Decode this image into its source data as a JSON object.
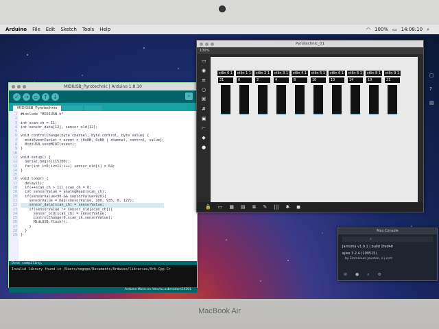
{
  "menubar": {
    "app": "Arduino",
    "items": [
      "File",
      "Edit",
      "Sketch",
      "Tools",
      "Help"
    ],
    "battery": "100%",
    "clock": "14:08:10"
  },
  "arduino": {
    "title": "MIDIUSB_Pyrotechnic | Arduino 1.8.10",
    "tabs": [
      "MIDIUSB_Pyrotechnic",
      "",
      ""
    ],
    "code_lines": [
      "#include \"MIDIUSB.h\"",
      "",
      "int scan_ch = 11;",
      "int sensor_data[12], sensor_old[12];",
      "",
      "void controlChange(byte channel, byte control, byte value) {",
      "  midiEventPacket_t event = {0x0B, 0xB0 | channel, control, value};",
      "  MidiUSB.sendMIDI(event);",
      "}",
      "",
      "void setup() {",
      "  Serial.begin(115200);",
      "  for(int i=0;i<=11;i++) sensor_old[i] = 64;",
      "}",
      "",
      "void loop() {",
      "  delay(1);",
      "  if(++scan_ch > 11) scan_ch = 0;",
      "  int sensorValue = analogRead(scan_ch);",
      "  if(sensorValue<30 && sensorValue>920){",
      "    sensorValue = map(sensorValue, 100, 935, 0, 127);",
      "    sensor_data[scan_ch] = sensorValue;",
      "    if(sensorValue != sensor_old[scan_ch]){",
      "      sensor_old[scan_ch] = sensorValue;",
      "      controlChange(0,scan_ch,sensorValue);",
      "      MidiUSB.flush();",
      "    }",
      "  }",
      "}"
    ],
    "line_numbers": [
      "1",
      "2",
      "3",
      "4",
      "5",
      "6",
      "7",
      "8",
      "9",
      "10",
      "11",
      "12",
      "13",
      "14",
      "15",
      "16",
      "17",
      "18",
      "19",
      "20",
      "21",
      "22",
      "23",
      "24",
      "25",
      "26",
      "27",
      "28",
      "29"
    ],
    "console_label": "Done compiling.",
    "console_text": "Invalid library found in /Users/negope/Documents/Arduino/libraries/Ark-Cpp-Cr",
    "status": "Arduino Micro on /dev/cu.usbmodem14301"
  },
  "pyro": {
    "title": "Pyrotechnic_01",
    "zoom": "100%",
    "faders": [
      {
        "label": "ctlin 0 1",
        "value": "21",
        "level": 0.05
      },
      {
        "label": "ctlin 1 1",
        "value": "0",
        "level": 0.03
      },
      {
        "label": "ctlin 2 1",
        "value": "2",
        "level": 0.03
      },
      {
        "label": "ctlin 3 1",
        "value": "4",
        "level": 0.03
      },
      {
        "label": "ctlin 4 1",
        "value": "8",
        "level": 0.04
      },
      {
        "label": "ctlin 5 1",
        "value": "10",
        "level": 0.04
      },
      {
        "label": "ctlin 6 1",
        "value": "10",
        "level": 0.04
      },
      {
        "label": "ctlin 6 1",
        "value": "14",
        "level": 0.05
      },
      {
        "label": "ctlin 8 1",
        "value": "19",
        "level": 0.05
      },
      {
        "label": "ctlin 9 1",
        "value": "21",
        "level": 0.05
      }
    ]
  },
  "about": {
    "title": "Max Console",
    "line1": "Jamoma v1.0.1 | build 1fed48",
    "line2": "ejies 3.2.4 (100515)",
    "line3": "by Emmanuel Jourdan, e-j.com"
  },
  "footer": {
    "brand": "MacBook Air"
  },
  "colors": {
    "arduino_teal": "#006468",
    "fader_fill": "#8fc4e3"
  }
}
